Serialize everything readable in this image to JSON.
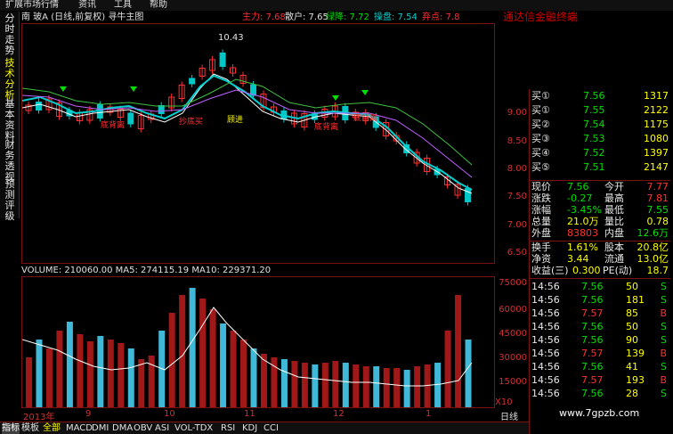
{
  "menu": [
    "扩展市场行情",
    "资讯",
    "工具",
    "帮助"
  ],
  "brand": "通达信金融终端",
  "info": {
    "stock_name": "南  玻A (日线,前复权) 寻牛主图",
    "main_force": "主力: 7.68",
    "retail": "散户: 7.65",
    "green_line": "绿降: 7.72",
    "operate": "操盘: 7.54",
    "escape": "弃点: 7.8"
  },
  "left_tabs": [
    "分时走势",
    "技术分析",
    "基本资料",
    "财务透视",
    "预测评级"
  ],
  "chart_annotations": {
    "high_label": "10.43",
    "signal_1": "底背离",
    "signal_2": "抄底买",
    "signal_3": "顾进",
    "signal_4": "底背离",
    "signal_5": "底背离"
  },
  "price_axis": [
    "9.00",
    "8.50",
    "8.00",
    "7.50",
    "7.00",
    "6.50"
  ],
  "volume_header": "VOLUME: 210060.00  MA5: 274115.19  MA10: 229371.20",
  "volume_axis": [
    "75000",
    "60000",
    "45000",
    "30000",
    "15000"
  ],
  "volume_unit": "X10",
  "date_axis": [
    "2013年",
    "9",
    "10",
    "11",
    "12",
    "1"
  ],
  "period": "日线",
  "bottom_tabs": [
    "指标",
    "模板",
    "全部",
    "MACD",
    "DMI",
    "DMA",
    "OBV",
    "ASI",
    "VOL-TDX",
    "RSI",
    "KDJ",
    "CCI"
  ],
  "order_book": [
    {
      "label": "买①",
      "price": "7.56",
      "vol": "1317"
    },
    {
      "label": "买①",
      "price": "7.55",
      "vol": "2122"
    },
    {
      "label": "买②",
      "price": "7.54",
      "vol": "1175"
    },
    {
      "label": "买③",
      "price": "7.53",
      "vol": "1080"
    },
    {
      "label": "买④",
      "price": "7.52",
      "vol": "1397"
    },
    {
      "label": "买⑤",
      "price": "7.51",
      "vol": "2147"
    }
  ],
  "quote": {
    "now_label": "现价",
    "now": "7.56",
    "open_label": "今开",
    "open": "7.77",
    "chg_label": "涨跌",
    "chg": "-0.27",
    "high_label": "最高",
    "high": "7.81",
    "pct_label": "涨幅",
    "pct": "-3.45%",
    "low_label": "最低",
    "low": "7.55",
    "total_label": "总量",
    "total": "21.0万",
    "ratio_label": "量比",
    "ratio": "0.78",
    "out_label": "外盘",
    "out": "83803",
    "in_label": "内盘",
    "in": "12.6万"
  },
  "stats": {
    "turnover_label": "换手",
    "turnover": "1.61%",
    "capital_label": "股本",
    "capital": "20.8亿",
    "netasset_label": "净资",
    "netasset": "3.44",
    "float_label": "流通",
    "float": "13.0亿",
    "eps_label": "收益(三)",
    "eps": "0.300",
    "pe_label": "PE(动)",
    "pe": "18.7"
  },
  "ticks": [
    {
      "time": "14:56",
      "price": "7.56",
      "vol": "50",
      "flag": "S"
    },
    {
      "time": "14:56",
      "price": "7.56",
      "vol": "181",
      "flag": "S"
    },
    {
      "time": "14:56",
      "price": "7.57",
      "vol": "85",
      "flag": "B"
    },
    {
      "time": "14:56",
      "price": "7.56",
      "vol": "50",
      "flag": "S"
    },
    {
      "time": "14:56",
      "price": "7.56",
      "vol": "90",
      "flag": "S"
    },
    {
      "time": "14:56",
      "price": "7.57",
      "vol": "139",
      "flag": "B"
    },
    {
      "time": "14:56",
      "price": "7.56",
      "vol": "41",
      "flag": "S"
    },
    {
      "time": "14:56",
      "price": "7.57",
      "vol": "193",
      "flag": "B"
    },
    {
      "time": "14:56",
      "price": "7.56",
      "vol": "28",
      "flag": "S"
    }
  ],
  "watermark": "www.7gpzb.com",
  "colors": {
    "up": "#ff3030",
    "down": "#00e000",
    "frame": "#7a1010",
    "accent": "#ffff00"
  }
}
